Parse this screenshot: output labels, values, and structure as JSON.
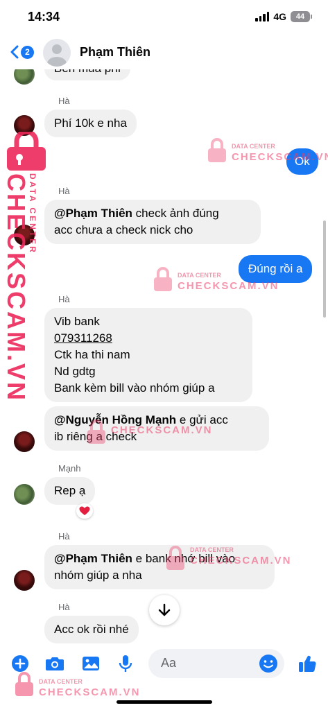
{
  "status": {
    "time": "14:34",
    "network": "4G",
    "battery": "44"
  },
  "header": {
    "back_count": "2",
    "contact_name": "Phạm Thiên"
  },
  "messages": {
    "m0": {
      "text": "Bên mua phí"
    },
    "m1": {
      "sender": "Hà",
      "text": "Phí 10k e nha"
    },
    "m2": {
      "text": "Ok"
    },
    "m3": {
      "sender": "Hà",
      "mention": "@Phạm Thiên",
      "line1_rest": " check ảnh đúng",
      "line2": "acc chưa a check nick cho"
    },
    "m4": {
      "text": "Đúng rồi a"
    },
    "m5": {
      "sender": "Hà",
      "line1": "Vib bank",
      "line2": "079311268",
      "line3": "Ctk ha thi nam",
      "line4": "Nd gdtg",
      "line5": "Bank kèm bill vào nhóm giúp a"
    },
    "m6": {
      "mention": "@Nguyễn Hồng Mạnh",
      "line1_rest": " e gửi acc",
      "line2": "ib riêng a check"
    },
    "m7": {
      "sender": "Mạnh",
      "text": "Rep ạ",
      "reaction": "❤️"
    },
    "m8": {
      "sender": "Hà",
      "mention": "@Phạm Thiên",
      "line1_rest": " e bank nhớ bill vào",
      "line2": "nhóm giúp a nha"
    },
    "m9": {
      "sender": "Hà",
      "text": "Acc ok rồi nhé"
    }
  },
  "composer": {
    "placeholder": "Aa"
  },
  "watermark": {
    "top": "DATA CENTER",
    "brand": "CHECKSCAM.VN"
  },
  "colors": {
    "accent": "#1877f2",
    "bubble_other": "#f0f0f0",
    "watermark": "#ec406c"
  },
  "icons": [
    "back-chevron-icon",
    "plus-icon",
    "camera-icon",
    "gallery-icon",
    "microphone-icon",
    "emoji-icon",
    "like-icon",
    "arrow-down-icon",
    "lock-icon"
  ]
}
